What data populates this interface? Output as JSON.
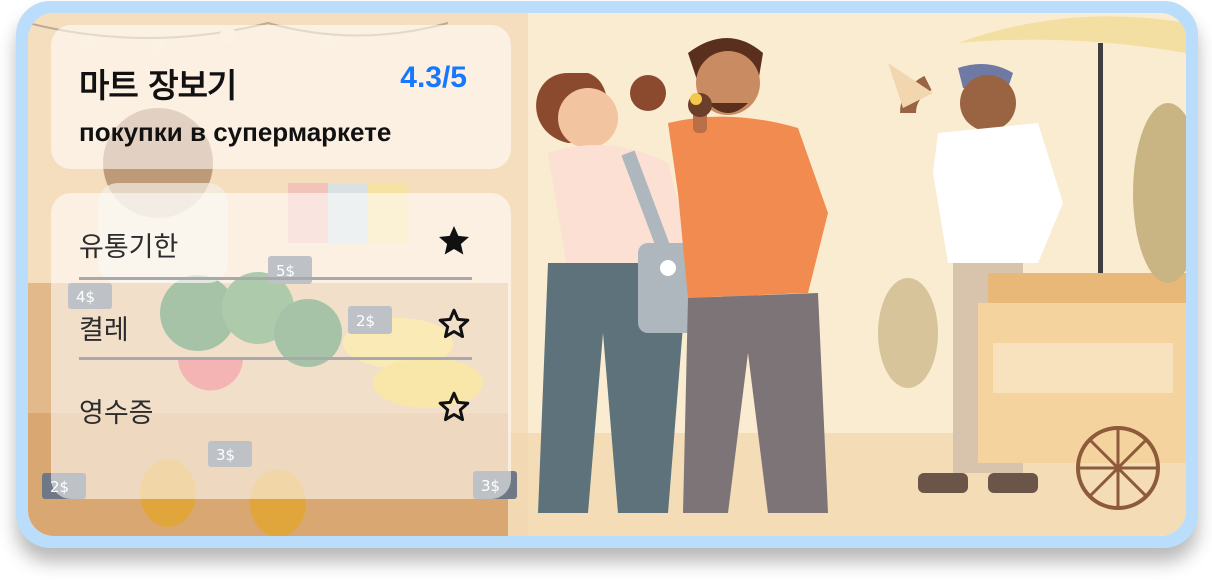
{
  "card": {
    "title": "마트 장보기",
    "rating": "4.3/5",
    "subtitle": "покупки в супермаркете"
  },
  "checklist": {
    "items": [
      {
        "label": "유통기한",
        "starred": true
      },
      {
        "label": "켤레",
        "starred": false
      },
      {
        "label": "영수증",
        "starred": false
      }
    ]
  },
  "background": {
    "price_tags": [
      "5$",
      "4$",
      "2$",
      "3$",
      "2$",
      "3$"
    ]
  },
  "colors": {
    "card_frame": "#b9ddfb",
    "rating": "#1677ff",
    "scene_bg": "#faecd0"
  }
}
